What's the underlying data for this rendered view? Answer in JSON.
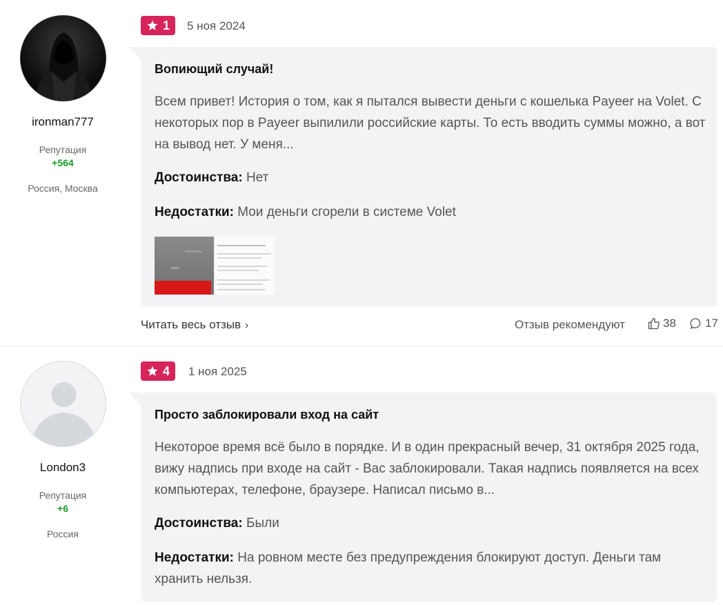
{
  "reviews": [
    {
      "author": "ironman777",
      "rep_label": "Репутация",
      "rep_value": "+564",
      "location": "Россия, Москва",
      "rating": "1",
      "date": "5 ноя 2024",
      "title": "Вопиющий случай!",
      "text": "Всем привет! История о том, как я пытался вывести деньги с кошелька Payeer на Volet. С некоторых пор в Payeer выпилили российские карты. То есть вводить суммы можно, а вот на вывод нет. У меня...",
      "pros_label": "Достоинства:",
      "pros": "Нет",
      "cons_label": "Недостатки:",
      "cons": "Мои деньги сгорели в системе Volet",
      "read_more": "Читать весь отзыв",
      "recommend": "Отзыв рекомендуют",
      "likes": "38",
      "comments": "17"
    },
    {
      "author": "London3",
      "rep_label": "Репутация",
      "rep_value": "+6",
      "location": "Россия",
      "rating": "4",
      "date": "1 ноя 2025",
      "title": "Просто заблокировали вход на сайт",
      "text": "Некоторое время всё было в порядке. И в один прекрасный вечер, 31 октября 2025 года, вижу надпись при входе на сайт - Вас заблокировали. Такая надпись появляется на всех компьютерах, телефоне, браузере. Написал письмо в...",
      "pros_label": "Достоинства:",
      "pros": "Были",
      "cons_label": "Недостатки:",
      "cons": "На ровном месте без предупреждения блокируют доступ. Деньги там хранить нельзя."
    }
  ],
  "colors": {
    "rating_badge": "#d7245a",
    "reputation": "#1a9a26",
    "card_bg": "#f3f3f5"
  },
  "icons": {
    "rating": "star-icon",
    "read_more": "chevron-right-icon",
    "likes": "thumbs-up-icon",
    "comments": "comment-icon"
  }
}
